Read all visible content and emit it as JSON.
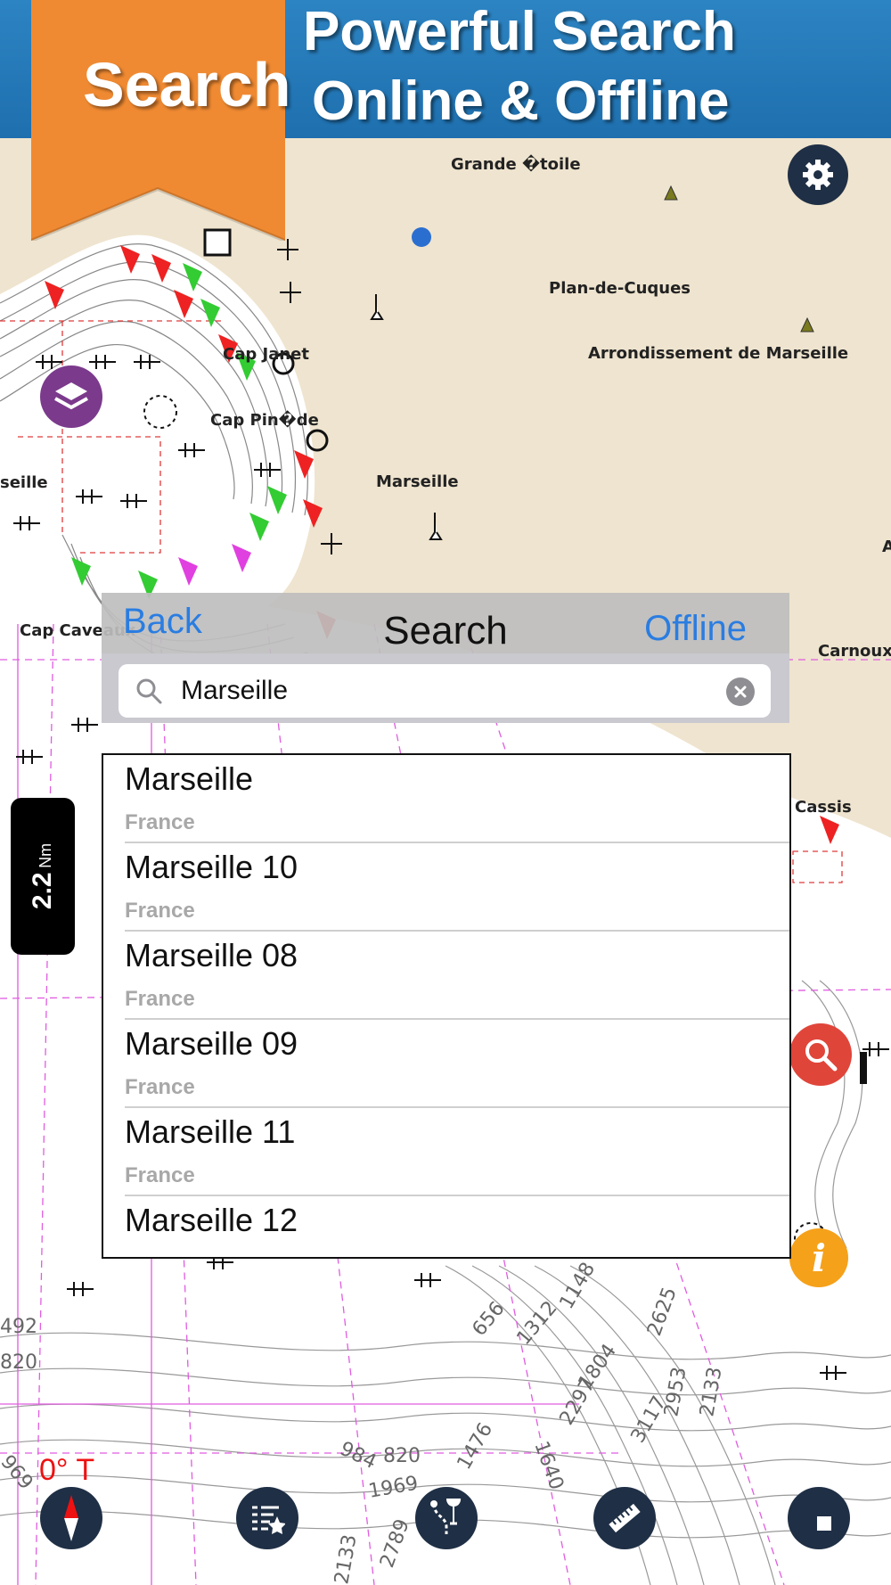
{
  "banner": {
    "ribbon_label": "Search",
    "headline_line1": "Powerful Search",
    "headline_line2": "Online & Offline"
  },
  "map": {
    "labels": [
      {
        "id": "grande-etoile",
        "text": "Grande �toile"
      },
      {
        "id": "plan-de-cuques",
        "text": "Plan-de-Cuques"
      },
      {
        "id": "arrondissement",
        "text": "Arrondissement de Marseille"
      },
      {
        "id": "cap-janet",
        "text": "Cap Janet"
      },
      {
        "id": "cap-pinede",
        "text": "Cap Pin�de"
      },
      {
        "id": "marseille",
        "text": "Marseille"
      },
      {
        "id": "seille",
        "text": "seille"
      },
      {
        "id": "cap-caveaux",
        "text": "Cap Caveaux"
      },
      {
        "id": "carnoux",
        "text": "Carnoux"
      },
      {
        "id": "cassis",
        "text": "Cassis"
      },
      {
        "id": "a-edge",
        "text": "A"
      }
    ],
    "depths": [
      "656",
      "1312",
      "1148",
      "1804",
      "2297",
      "2625",
      "3117",
      "2953",
      "2133",
      "1640",
      "1476",
      "984",
      "820",
      "1969",
      "2133",
      "2789",
      "492",
      "820",
      "969"
    ]
  },
  "search_panel": {
    "back_label": "Back",
    "title": "Search",
    "offline_label": "Offline",
    "query": "Marseille",
    "results": [
      {
        "name": "Marseille",
        "country": "France"
      },
      {
        "name": "Marseille 10",
        "country": "France"
      },
      {
        "name": "Marseille 08",
        "country": "France"
      },
      {
        "name": "Marseille 09",
        "country": "France"
      },
      {
        "name": "Marseille 11",
        "country": "France"
      },
      {
        "name": "Marseille 12",
        "country": ""
      }
    ]
  },
  "scale": {
    "value": "2.2",
    "unit": "Nm"
  },
  "compass": {
    "heading": "0° T"
  },
  "colors": {
    "banner": "#1e6fae",
    "ribbon": "#f08a32",
    "accent_blue": "#2a7de1",
    "search_button": "#e0453a",
    "info_button": "#f5a11a",
    "layers_button": "#7b3a8c",
    "dark_button": "#1f2f45",
    "land": "#efe4cf",
    "water": "#ffffff"
  }
}
